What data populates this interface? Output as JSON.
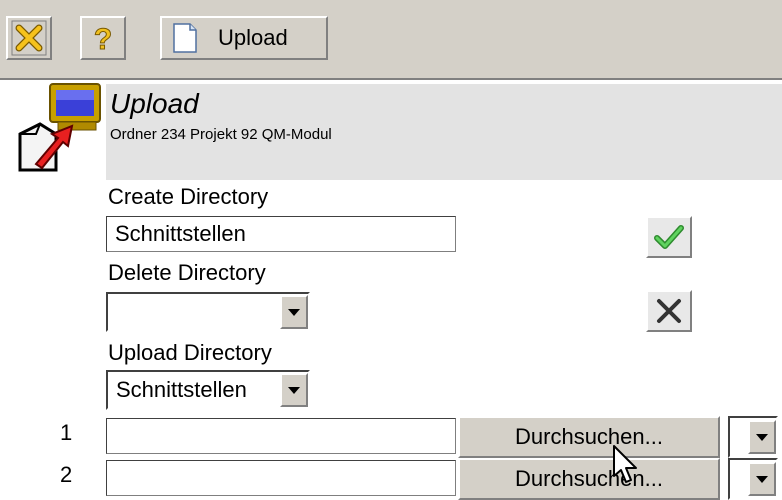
{
  "toolbar": {
    "close_icon": "close-icon",
    "help_icon": "help-icon",
    "upload_label": "Upload",
    "upload_icon": "document-icon"
  },
  "header": {
    "icon": "upload-computer-icon",
    "title": "Upload",
    "subtitle": "Ordner 234 Projekt 92 QM-Modul"
  },
  "create_directory": {
    "label": "Create Directory",
    "value": "Schnittstellen",
    "confirm_icon": "checkmark-icon"
  },
  "delete_directory": {
    "label": "Delete Directory",
    "selected": "",
    "delete_icon": "x-icon"
  },
  "upload_directory": {
    "label": "Upload Directory",
    "selected": "Schnittstellen"
  },
  "file_rows": [
    {
      "number": "1",
      "value": "",
      "browse_label": "Durchsuchen..."
    },
    {
      "number": "2",
      "value": "",
      "browse_label": "Durchsuchen..."
    }
  ],
  "colors": {
    "toolbar_bg": "#d4d0c8",
    "header_bg": "#e3e3e3",
    "confirm_green": "#3cb043",
    "close_yellow": "#f0c020"
  }
}
